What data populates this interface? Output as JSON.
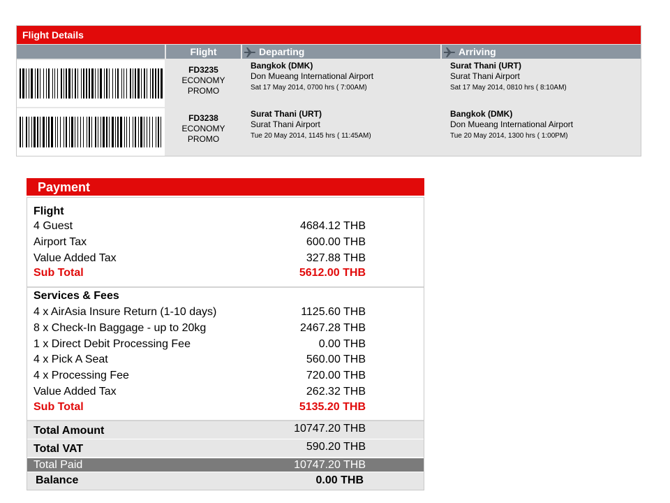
{
  "flight_details": {
    "title": "Flight Details",
    "headers": {
      "flight": "Flight",
      "departing": "Departing",
      "arriving": "Arriving"
    },
    "rows": [
      {
        "flight_no": "FD3235",
        "fare_class": "ECONOMY",
        "fare_type": "PROMO",
        "departing": {
          "city": "Bangkok (DMK)",
          "airport": "Don Mueang International Airport",
          "datetime": "Sat 17 May 2014, 0700 hrs ( 7:00AM)"
        },
        "arriving": {
          "city": "Surat Thani (URT)",
          "airport": "Surat Thani Airport",
          "datetime": "Sat 17 May 2014, 0810 hrs ( 8:10AM)"
        }
      },
      {
        "flight_no": "FD3238",
        "fare_class": "ECONOMY",
        "fare_type": "PROMO",
        "departing": {
          "city": "Surat Thani (URT)",
          "airport": "Surat Thani Airport",
          "datetime": "Tue 20 May 2014, 1145 hrs ( 11:45AM)"
        },
        "arriving": {
          "city": "Bangkok (DMK)",
          "airport": "Don Mueang International Airport",
          "datetime": "Tue 20 May 2014, 1300 hrs ( 1:00PM)"
        }
      }
    ]
  },
  "payment": {
    "title": "Payment",
    "flight_section": {
      "heading": "Flight",
      "items": [
        {
          "label": "4 Guest",
          "value": "4684.12 THB"
        },
        {
          "label": "Airport Tax",
          "value": "600.00 THB"
        },
        {
          "label": "Value Added Tax",
          "value": "327.88 THB"
        }
      ],
      "subtotal": {
        "label": "Sub Total",
        "value": "5612.00 THB"
      }
    },
    "services_section": {
      "heading": "Services & Fees",
      "items": [
        {
          "label": "4 x AirAsia Insure Return (1-10 days)",
          "value": "1125.60 THB"
        },
        {
          "label": "8 x Check-In Baggage - up to 20kg",
          "value": "2467.28 THB"
        },
        {
          "label": "1 x Direct Debit Processing Fee",
          "value": "0.00 THB"
        },
        {
          "label": "4 x Pick A Seat",
          "value": "560.00 THB"
        },
        {
          "label": "4 x Processing Fee",
          "value": "720.00 THB"
        },
        {
          "label": "Value Added Tax",
          "value": "262.32 THB"
        }
      ],
      "subtotal": {
        "label": "Sub Total",
        "value": "5135.20 THB"
      }
    },
    "totals": {
      "total_amount": {
        "label": "Total Amount",
        "value": "10747.20 THB"
      },
      "total_vat": {
        "label": "Total VAT",
        "value": "590.20 THB"
      },
      "total_paid": {
        "label": "Total Paid",
        "value": "10747.20 THB"
      },
      "balance": {
        "label": "Balance",
        "value": "0.00 THB"
      }
    }
  },
  "colors": {
    "brand_red": "#e10a0a",
    "header_gray": "#8b96a1",
    "row_gray": "#e6e6e6",
    "paid_gray": "#7b7b7b"
  },
  "icons": {
    "departing": "plane-icon",
    "arriving": "plane-icon",
    "boarding_pass": "barcode"
  }
}
